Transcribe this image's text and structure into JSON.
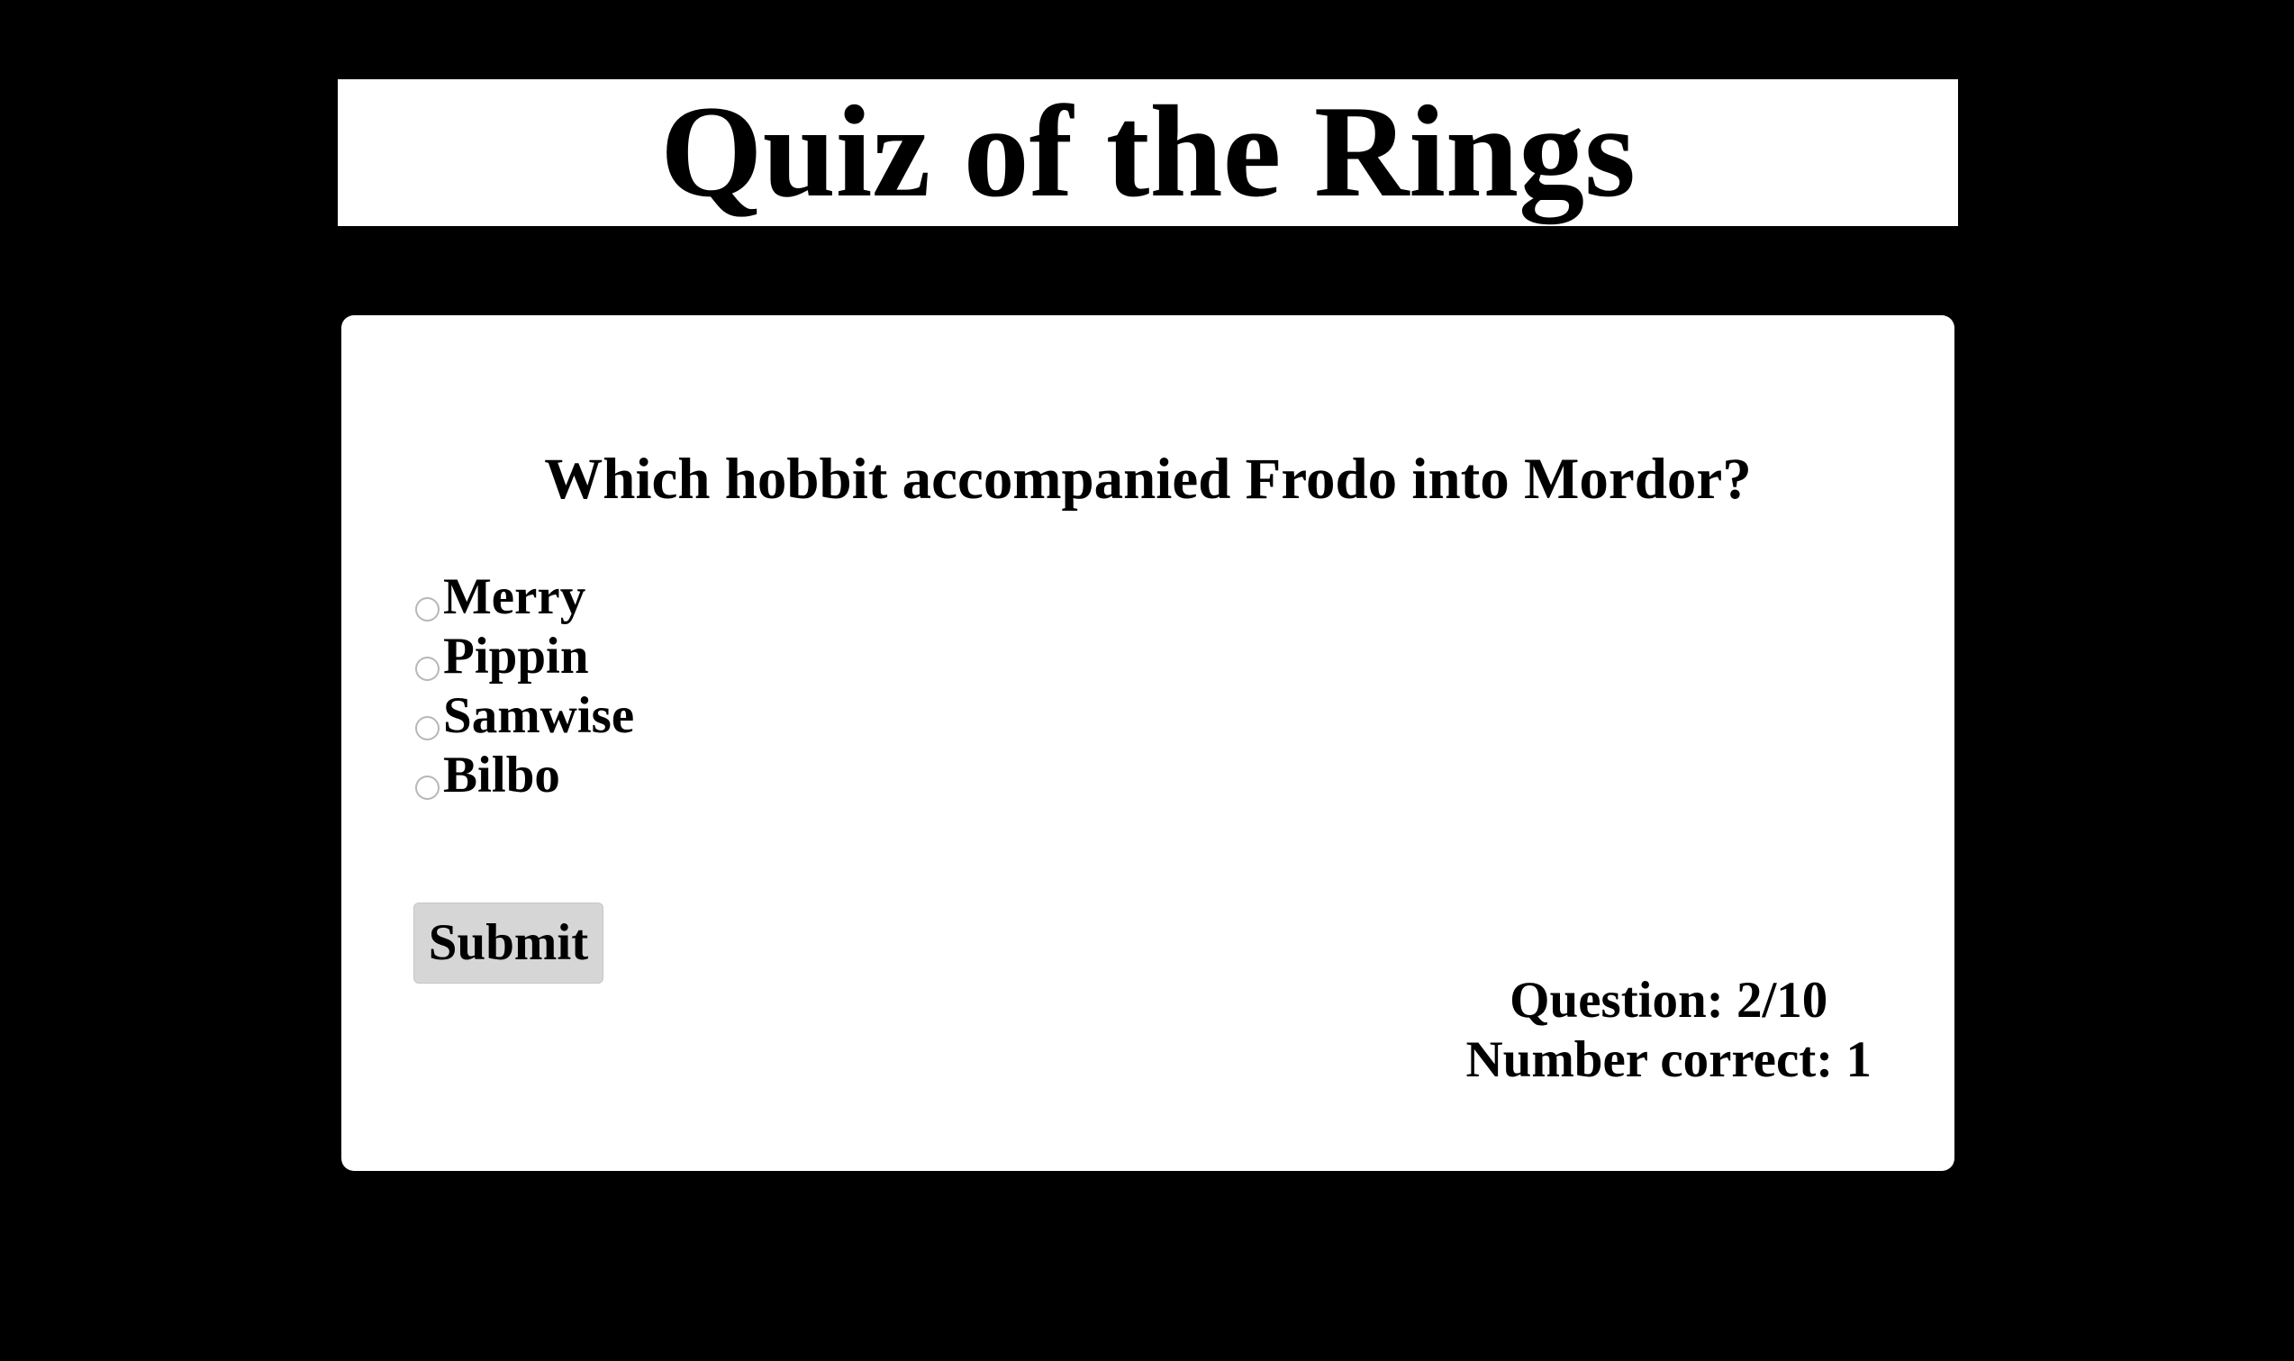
{
  "header": {
    "title": "Quiz of the Rings"
  },
  "quiz": {
    "question": "Which hobbit accompanied Frodo into Mordor?",
    "options": [
      {
        "label": "Merry",
        "selected": false
      },
      {
        "label": "Pippin",
        "selected": false
      },
      {
        "label": "Samwise",
        "selected": false
      },
      {
        "label": "Bilbo",
        "selected": false
      }
    ],
    "submit_label": "Submit",
    "progress_text": "Question: 2/10",
    "score_text": "Number correct: 1"
  },
  "colors": {
    "page_background": "#000000",
    "panel_background": "#ffffff",
    "button_background": "#d6d6d6",
    "radio_border": "#b7b7b7",
    "text": "#000000"
  }
}
